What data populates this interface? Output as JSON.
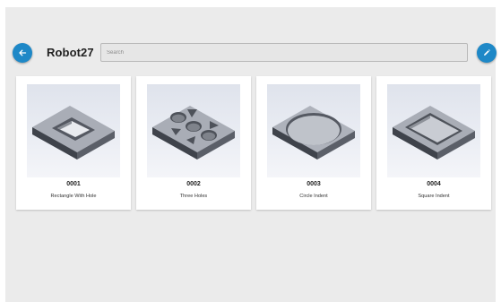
{
  "header": {
    "title": "Robot27",
    "search_placeholder": "Search",
    "back_icon": "arrow-left-icon",
    "edit_icon": "pencil-icon"
  },
  "colors": {
    "accent": "#1e88c7",
    "background": "#ebebeb",
    "card": "#ffffff"
  },
  "parts": [
    {
      "code": "0001",
      "name": "Rectangle With Hole",
      "icon": "rectangle-with-hole-part-icon"
    },
    {
      "code": "0002",
      "name": "Three Holes",
      "icon": "three-holes-part-icon"
    },
    {
      "code": "0003",
      "name": "Circle Indent",
      "icon": "circle-indent-part-icon"
    },
    {
      "code": "0004",
      "name": "Square Indent",
      "icon": "square-indent-part-icon"
    }
  ]
}
